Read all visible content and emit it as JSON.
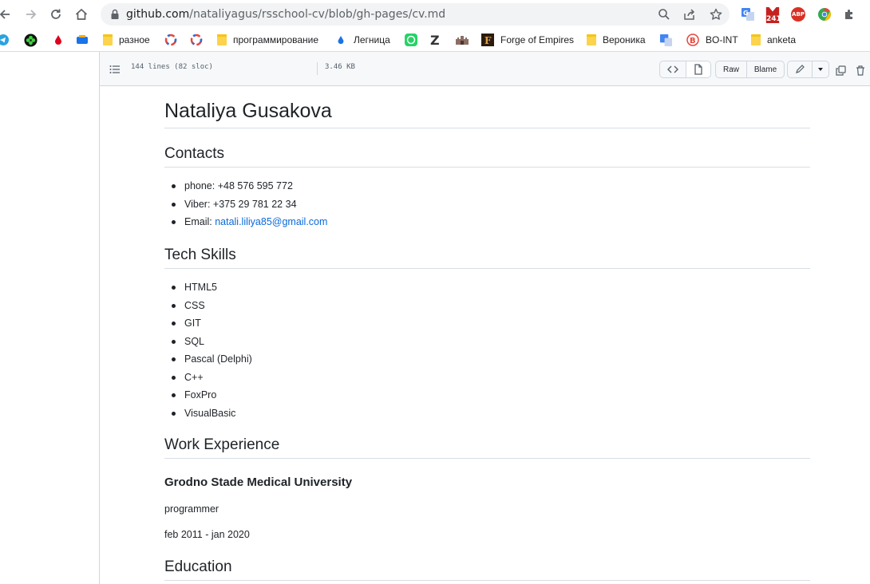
{
  "browser": {
    "url_host": "github.com",
    "url_path": "/nataliyagus/rsschool-cv/blob/gh-pages/cv.md",
    "extensions": {
      "mail_badge": "241",
      "abp_label": "ABP"
    },
    "bookmarks": [
      {
        "label": "",
        "icon": "telegram-icon"
      },
      {
        "label": "",
        "icon": "green-clover-icon"
      },
      {
        "label": "",
        "icon": "red-drop-icon"
      },
      {
        "label": "",
        "icon": "tvs-icon"
      },
      {
        "label": "разное",
        "icon": "folder-icon"
      },
      {
        "label": "",
        "icon": "ring-icon"
      },
      {
        "label": "",
        "icon": "ring-icon"
      },
      {
        "label": "программирование",
        "icon": "folder-icon"
      },
      {
        "label": "Легница",
        "icon": "drop-icon"
      },
      {
        "label": "",
        "icon": "whatsapp-icon"
      },
      {
        "label": "",
        "icon": "z-icon"
      },
      {
        "label": "",
        "icon": "castle-icon"
      },
      {
        "label": "Forge of Empires",
        "icon": "foe-icon"
      },
      {
        "label": "Вероника",
        "icon": "folder-icon"
      },
      {
        "label": "",
        "icon": "translate-icon"
      },
      {
        "label": "BO-INT",
        "icon": "bo-int-icon"
      },
      {
        "label": "anketa",
        "icon": "folder-icon"
      }
    ]
  },
  "file_header": {
    "lines": "144 lines (82 sloc)",
    "size": "3.46 KB",
    "raw_label": "Raw",
    "blame_label": "Blame"
  },
  "cv": {
    "name": "Nataliya Gusakova",
    "contacts_heading": "Contacts",
    "contacts": {
      "phone": "phone: +48 576 595 772",
      "viber": "Viber: +375 29 781 22 34",
      "email_label": "Email: ",
      "email": "natali.liliya85@gmail.com"
    },
    "skills_heading": "Tech Skills",
    "skills": [
      "HTML5",
      "CSS",
      "GIT",
      "SQL",
      "Pascal (Delphi)",
      "C++",
      "FoxPro",
      "VisualBasic"
    ],
    "work_heading": "Work Experience",
    "work": {
      "employer": "Grodno Stade Medical University",
      "position": "programmer",
      "period": "feb 2011 - jan 2020"
    },
    "education_heading": "Education"
  }
}
